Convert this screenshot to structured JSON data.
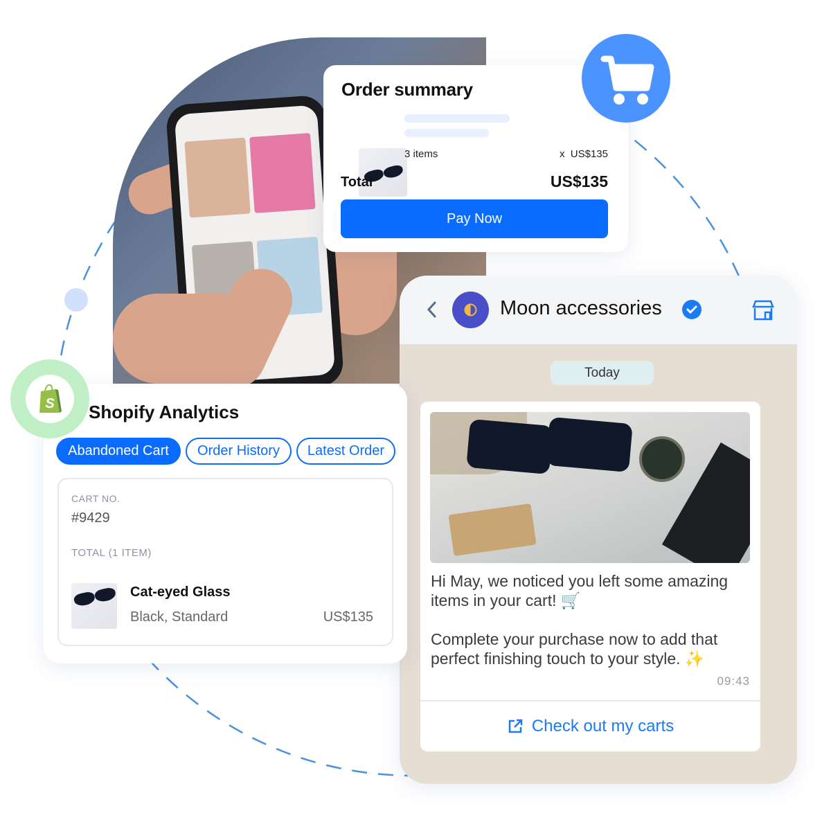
{
  "order_summary": {
    "title": "Order summary",
    "items_label": "3 items",
    "unit_price": "x  US$135",
    "total_label": "Total",
    "total_value": "US$135",
    "pay_button": "Pay Now"
  },
  "cart_badge": {
    "icon": "shopping-cart-icon",
    "color": "#4b94ff"
  },
  "chat": {
    "contact_name": "Moon accessories",
    "verified_icon": "verified-badge-icon",
    "date_label": "Today",
    "message_line1": "Hi May, we noticed you left some amazing items in your cart! 🛒",
    "message_line2": "Complete your purchase now to add that perfect finishing touch to your style. ✨",
    "time": "09:43",
    "cta_label": "Check out my carts",
    "cta_icon": "external-link-icon"
  },
  "shopify": {
    "title": "Shopify Analytics",
    "tabs": [
      {
        "label": "Abandoned Cart",
        "active": true
      },
      {
        "label": "Order History",
        "active": false
      },
      {
        "label": "Latest Order",
        "active": false
      }
    ],
    "cart_no_label": "CART NO.",
    "cart_no": "#9429",
    "total_label": "TOTAL (1 ITEM)",
    "product_name": "Cat-eyed Glass",
    "product_variant": "Black, Standard",
    "product_price": "US$135"
  },
  "colors": {
    "primary": "#0a6cff",
    "shopify_green": "#95bf47",
    "chat_bg": "#e6ddd3"
  }
}
